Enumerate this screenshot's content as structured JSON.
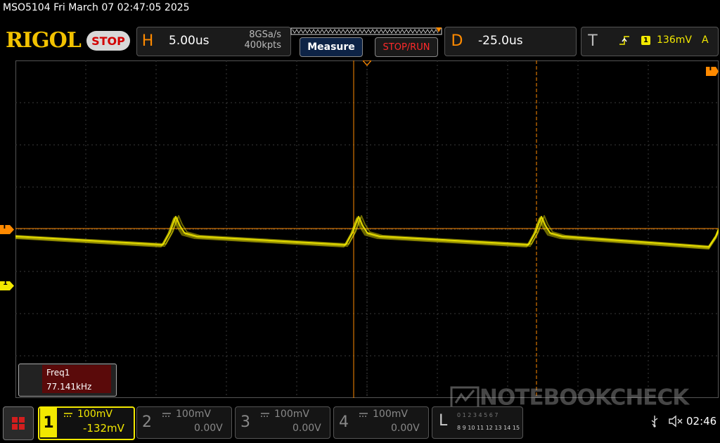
{
  "header": {
    "title": "MSO5104  Fri March 07 02:47:05 2025",
    "logo": "RIGOL",
    "run_state": "STOP",
    "horizontal": {
      "letter": "H",
      "timebase": "5.00us",
      "sample_rate": "8GSa/s",
      "memory_depth": "400kpts"
    },
    "measure_label": "Measure",
    "stop_run_label": "STOP/RUN",
    "delay": {
      "letter": "D",
      "value": "-25.0us"
    },
    "trigger": {
      "letter": "T",
      "channel": "1",
      "level": "136mV",
      "mode": "A"
    }
  },
  "screen": {
    "trigger_marker": "T",
    "channel1_marker": "1",
    "measurement": {
      "label": "Freq1",
      "value": "77.141kHz"
    },
    "watermark": "NOTEBOOKCHECK"
  },
  "channels": [
    {
      "num": "1",
      "scale": "100mV",
      "offset": "-132mV",
      "active": true
    },
    {
      "num": "2",
      "scale": "100mV",
      "offset": "0.00V",
      "active": false
    },
    {
      "num": "3",
      "scale": "100mV",
      "offset": "0.00V",
      "active": false
    },
    {
      "num": "4",
      "scale": "100mV",
      "offset": "0.00V",
      "active": false
    }
  ],
  "logic": {
    "letter": "L",
    "row1": "0 1 2 3 4 5 6 7",
    "row2": "8 9 10 11 12 13 14 15"
  },
  "status": {
    "time": "02:46"
  },
  "colors": {
    "ch1": "#f2e800",
    "accent": "#ff8a00",
    "grid": "#3a3a3a",
    "stop_red": "#d20000"
  }
}
